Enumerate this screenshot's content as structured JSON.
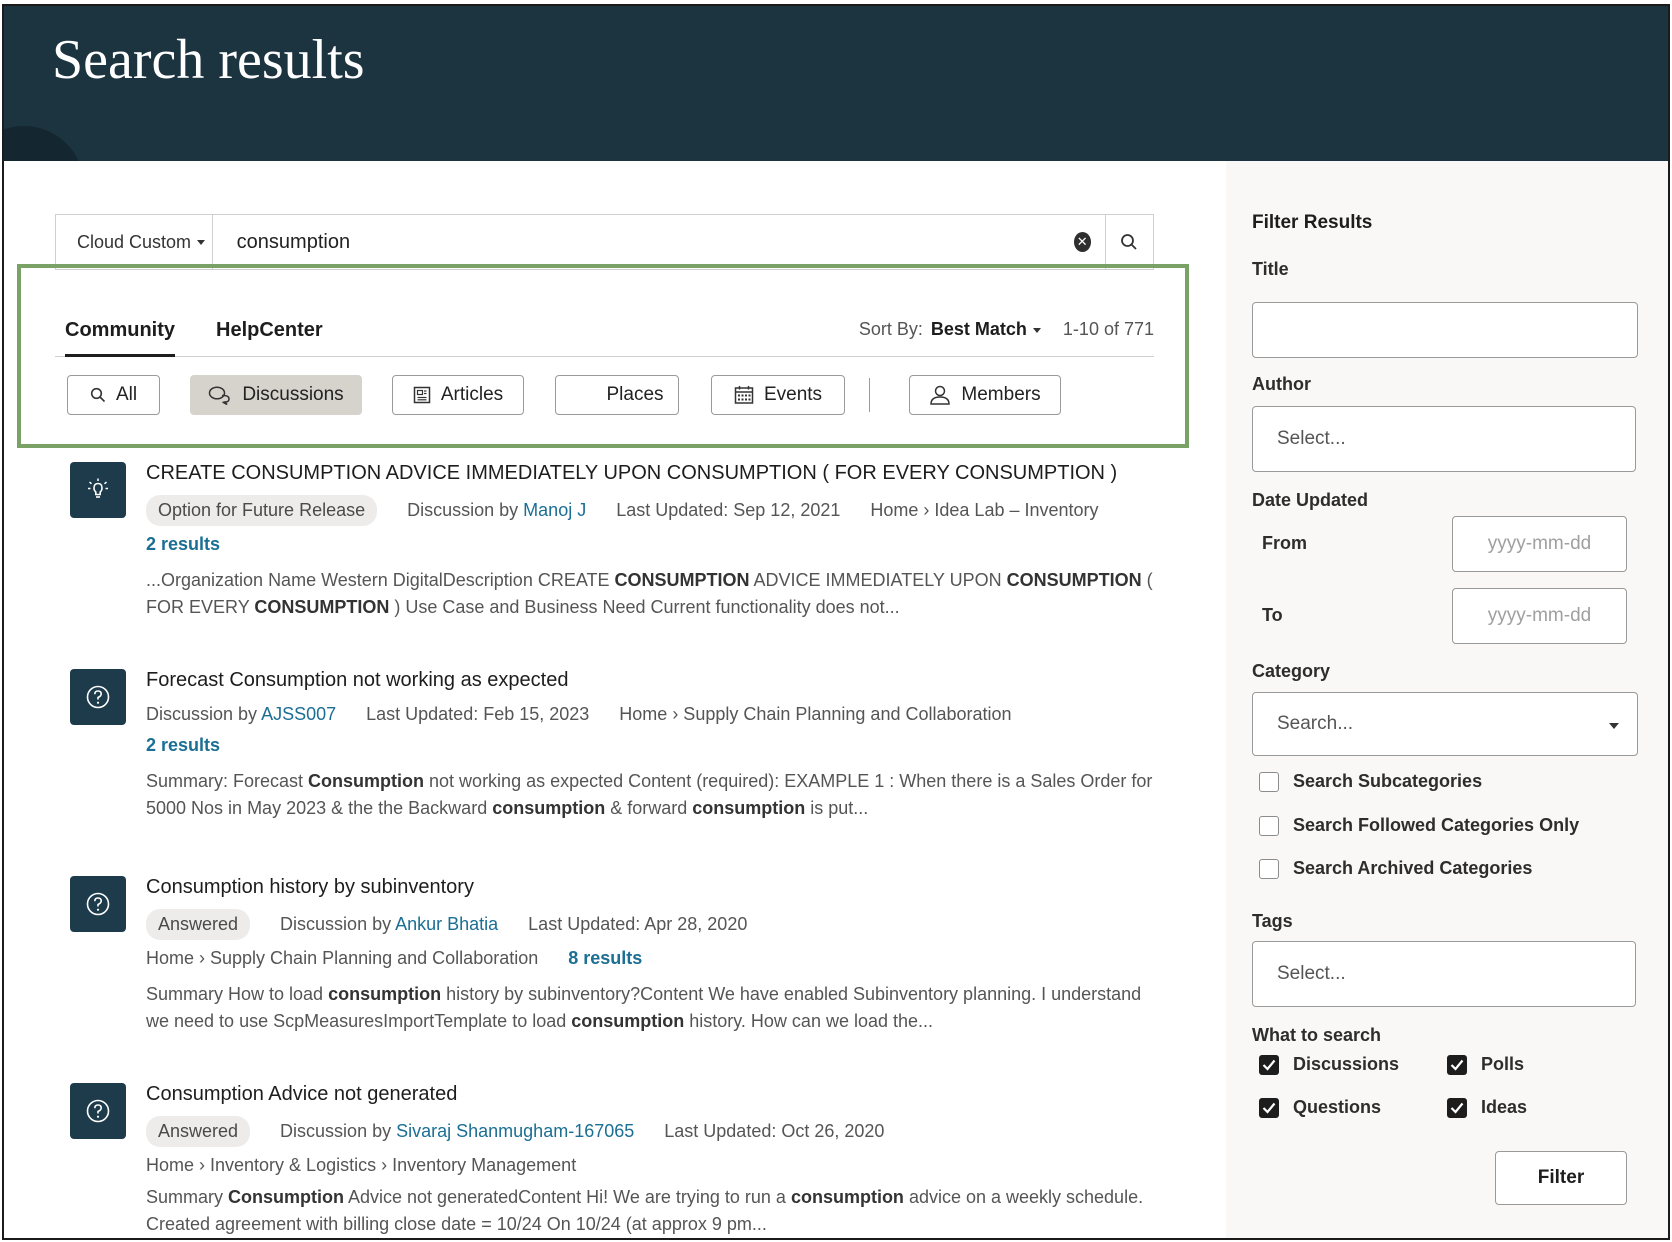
{
  "header": {
    "title": "Search results"
  },
  "search": {
    "scope_label": "Cloud Custom",
    "query": "consumption",
    "clear_icon": "close-circle-icon",
    "search_icon": "magnifier-icon"
  },
  "tabs": [
    {
      "label": "Community",
      "active": true
    },
    {
      "label": "HelpCenter",
      "active": false
    }
  ],
  "sort": {
    "label": "Sort By:",
    "value": "Best Match",
    "count": "1-10 of 771"
  },
  "chips": [
    {
      "label": "All",
      "icon": "search-icon",
      "active": false
    },
    {
      "label": "Discussions",
      "icon": "chat-bubbles-icon",
      "active": true
    },
    {
      "label": "Articles",
      "icon": "article-icon",
      "active": false
    },
    {
      "label": "Places",
      "icon": "",
      "active": false
    },
    {
      "label": "Events",
      "icon": "calendar-icon",
      "active": false
    },
    {
      "label": "Members",
      "icon": "person-icon",
      "active": false
    }
  ],
  "results": [
    {
      "icon": "lightbulb-icon",
      "title": "CREATE CONSUMPTION ADVICE IMMEDIATELY UPON CONSUMPTION ( FOR EVERY CONSUMPTION )",
      "badge": "Option for Future Release",
      "discussion_prefix": "Discussion by",
      "author": "Manoj J",
      "updated": "Last Updated: Sep 12, 2021",
      "breadcrumb": "Home › Idea Lab – Inventory",
      "results_count": "2 results",
      "snippet_parts": [
        {
          "t": "...Organization Name Western DigitalDescription CREATE ",
          "b": false
        },
        {
          "t": "CONSUMPTION",
          "b": true
        },
        {
          "t": " ADVICE IMMEDIATELY UPON ",
          "b": false
        },
        {
          "t": "CONSUMPTION",
          "b": true
        },
        {
          "t": " ( FOR EVERY ",
          "b": false
        },
        {
          "t": "CONSUMPTION",
          "b": true
        },
        {
          "t": " ) Use Case and Business Need Current functionality does not...",
          "b": false
        }
      ]
    },
    {
      "icon": "question-circle-icon",
      "title": "Forecast Consumption not working as expected",
      "badge": "",
      "discussion_prefix": "Discussion by",
      "author": "AJSS007",
      "updated": "Last Updated: Feb 15, 2023",
      "breadcrumb": "Home › Supply Chain Planning and Collaboration",
      "results_count": "2 results",
      "snippet_parts": [
        {
          "t": "Summary: Forecast ",
          "b": false
        },
        {
          "t": "Consumption",
          "b": true
        },
        {
          "t": " not working as expected Content (required): EXAMPLE 1 : When there is a Sales Order for 5000 Nos in May 2023 & the the Backward ",
          "b": false
        },
        {
          "t": "consumption",
          "b": true
        },
        {
          "t": " & forward ",
          "b": false
        },
        {
          "t": "consumption",
          "b": true
        },
        {
          "t": " is put...",
          "b": false
        }
      ]
    },
    {
      "icon": "question-circle-icon",
      "title": "Consumption history by subinventory",
      "badge": "Answered",
      "discussion_prefix": "Discussion by",
      "author": "Ankur Bhatia",
      "updated": "Last Updated: Apr 28, 2020",
      "breadcrumb": "Home › Supply Chain Planning and Collaboration",
      "results_count": "8 results",
      "snippet_parts": [
        {
          "t": "Summary How to load ",
          "b": false
        },
        {
          "t": "consumption",
          "b": true
        },
        {
          "t": " history by subinventory?Content We have enabled Subinventory planning. I understand we need to use ScpMeasuresImportTemplate to load ",
          "b": false
        },
        {
          "t": "consumption",
          "b": true
        },
        {
          "t": " history. How can we load the...",
          "b": false
        }
      ]
    },
    {
      "icon": "question-circle-icon",
      "title": "Consumption Advice not generated",
      "badge": "Answered",
      "discussion_prefix": "Discussion by",
      "author": "Sivaraj Shanmugham-167065",
      "updated": "Last Updated: Oct 26, 2020",
      "breadcrumb": "Home › Inventory & Logistics › Inventory Management",
      "results_count": "",
      "snippet_parts": [
        {
          "t": "Summary ",
          "b": false
        },
        {
          "t": "Consumption",
          "b": true
        },
        {
          "t": " Advice not generatedContent Hi! We are trying to run a ",
          "b": false
        },
        {
          "t": "consumption",
          "b": true
        },
        {
          "t": " advice on a weekly schedule. Created agreement with billing close date = 10/24 On 10/24 (at approx 9 pm...",
          "b": false
        }
      ]
    }
  ],
  "filters": {
    "heading": "Filter Results",
    "title_label": "Title",
    "title_value": "",
    "author_label": "Author",
    "author_placeholder": "Select...",
    "date_label": "Date Updated",
    "from_label": "From",
    "to_label": "To",
    "date_placeholder": "yyyy-mm-dd",
    "category_label": "Category",
    "category_placeholder": "Search...",
    "checkbox_options": [
      {
        "label": "Search Subcategories",
        "checked": false
      },
      {
        "label": "Search Followed Categories Only",
        "checked": false
      },
      {
        "label": "Search Archived Categories",
        "checked": false
      }
    ],
    "tags_label": "Tags",
    "tags_placeholder": "Select...",
    "what_label": "What to search",
    "what_options": [
      {
        "label": "Discussions",
        "checked": true
      },
      {
        "label": "Polls",
        "checked": true
      },
      {
        "label": "Questions",
        "checked": true
      },
      {
        "label": "Ideas",
        "checked": true
      }
    ],
    "filter_button": "Filter"
  },
  "colors": {
    "banner": "#1c3340",
    "icon_tile": "#1d3b4b",
    "link": "#1b6e94",
    "highlight": "#7aa267",
    "active_chip": "#d6d2cc"
  }
}
